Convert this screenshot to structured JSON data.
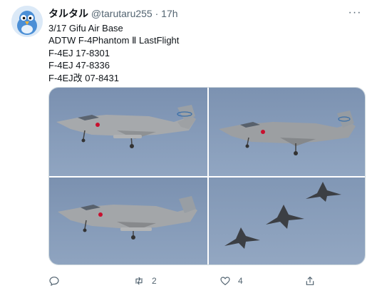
{
  "tweet": {
    "display_name": "タルタル",
    "handle": "@tarutaru255",
    "separator": "·",
    "time": "17h",
    "text_lines": [
      "3/17 Gifu Air Base",
      "ADTW F-4Phantom Ⅱ LastFlight",
      "F-4EJ 17-8301",
      "F-4EJ 47-8336",
      "F-4EJ改 07-8431"
    ],
    "more_label": "···"
  },
  "media": {
    "photos": [
      {
        "icon": "f4-phantom-landing-gear-down"
      },
      {
        "icon": "f4-phantom-landing-gear-down"
      },
      {
        "icon": "f4-phantom-landing-gear-down"
      },
      {
        "icon": "three-jets-formation"
      }
    ]
  },
  "actions": {
    "reply": {
      "icon": "reply-icon",
      "count": ""
    },
    "retweet": {
      "icon": "retweet-icon",
      "count": "2"
    },
    "like": {
      "icon": "heart-icon",
      "count": "4"
    },
    "share": {
      "icon": "share-icon",
      "count": ""
    }
  },
  "colors": {
    "text": "#0f1419",
    "secondary": "#536471",
    "sky_top": "#7f95b4",
    "sky_bottom": "#8ea3c0"
  }
}
